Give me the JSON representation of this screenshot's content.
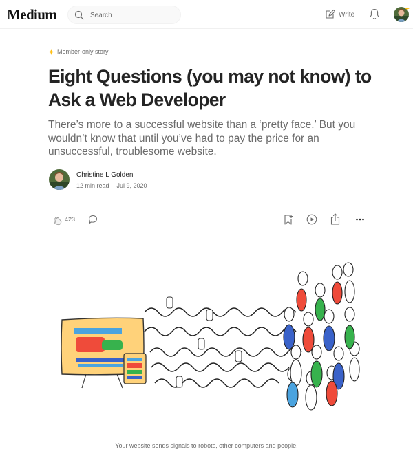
{
  "app": {
    "logo": "Medium"
  },
  "header": {
    "search_placeholder": "Search",
    "write_label": "Write"
  },
  "article": {
    "badge": "Member-only story",
    "title": "Eight Questions (you may not know) to Ask a Web Developer",
    "subtitle": "There’s more to a successful website than a ‘pretty face.’ But you wouldn’t know that until you’ve had to pay the price for an unsuccessful, troublesome website.",
    "author": "Christine L Golden",
    "read_time": "12 min read",
    "separator": "·",
    "date": "Jul 9, 2020",
    "claps": "423",
    "caption": "Your website sends signals to robots, other computers and people."
  },
  "colors": {
    "member_star": "#ffc017",
    "text_primary": "#242424",
    "text_secondary": "#6b6b6b"
  },
  "icons": [
    "search-icon",
    "write-icon",
    "bell-icon",
    "star-icon",
    "clap-icon",
    "comment-icon",
    "bookmark-icon",
    "play-icon",
    "share-icon",
    "more-icon"
  ]
}
